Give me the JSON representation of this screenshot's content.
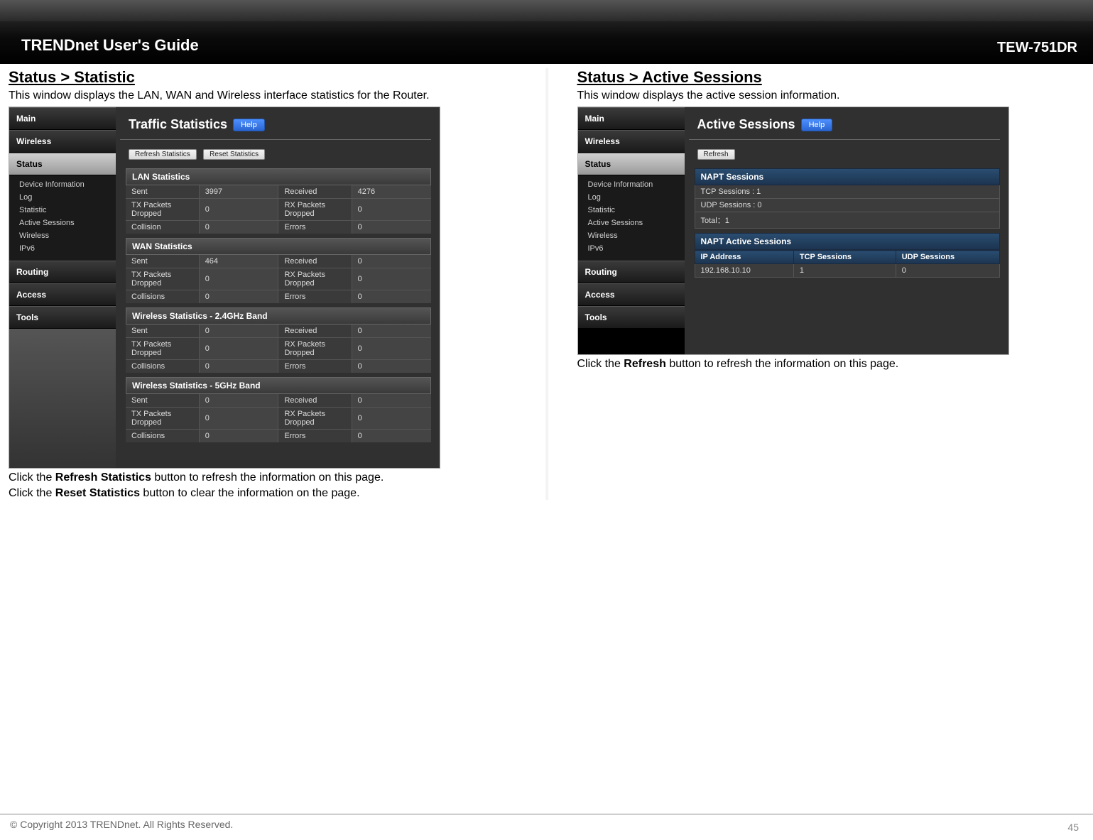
{
  "header": {
    "guide": "TRENDnet User's Guide",
    "model": "TEW-751DR"
  },
  "left": {
    "title": "Status > Statistic",
    "desc": "This window displays the LAN, WAN and Wireless interface statistics for the Router.",
    "panel_title": "Traffic Statistics",
    "help": "Help",
    "btn_refresh": "Refresh Statistics",
    "btn_reset": "Reset Statistics",
    "sections": {
      "lan": {
        "head": "LAN Statistics",
        "r1c1": "Sent",
        "r1c2": "3997",
        "r1c3": "Received",
        "r1c4": "4276",
        "r2c1": "TX Packets Dropped",
        "r2c2": "0",
        "r2c3": "RX Packets Dropped",
        "r2c4": "0",
        "r3c1": "Collision",
        "r3c2": "0",
        "r3c3": "Errors",
        "r3c4": "0"
      },
      "wan": {
        "head": "WAN Statistics",
        "r1c1": "Sent",
        "r1c2": "464",
        "r1c3": "Received",
        "r1c4": "0",
        "r2c1": "TX Packets Dropped",
        "r2c2": "0",
        "r2c3": "RX Packets Dropped",
        "r2c4": "0",
        "r3c1": "Collisions",
        "r3c2": "0",
        "r3c3": "Errors",
        "r3c4": "0"
      },
      "w24": {
        "head": "Wireless Statistics - 2.4GHz Band",
        "r1c1": "Sent",
        "r1c2": "0",
        "r1c3": "Received",
        "r1c4": "0",
        "r2c1": "TX Packets Dropped",
        "r2c2": "0",
        "r2c3": "RX Packets Dropped",
        "r2c4": "0",
        "r3c1": "Collisions",
        "r3c2": "0",
        "r3c3": "Errors",
        "r3c4": "0"
      },
      "w5": {
        "head": "Wireless Statistics - 5GHz Band",
        "r1c1": "Sent",
        "r1c2": "0",
        "r1c3": "Received",
        "r1c4": "0",
        "r2c1": "TX Packets Dropped",
        "r2c2": "0",
        "r2c3": "RX Packets Dropped",
        "r2c4": "0",
        "r3c1": "Collisions",
        "r3c2": "0",
        "r3c3": "Errors",
        "r3c4": "0"
      }
    },
    "instr1_pre": "Click the ",
    "instr1_b": "Refresh Statistics",
    "instr1_post": " button to refresh the information on this page.",
    "instr2_pre": "Click the ",
    "instr2_b": "Reset Statistics",
    "instr2_post": " button to clear the information on the page."
  },
  "right": {
    "title": "Status > Active Sessions",
    "desc": "This window displays the active session information.",
    "panel_title": "Active Sessions",
    "help": "Help",
    "btn_refresh": "Refresh",
    "napt_head": "NAPT Sessions",
    "tcp": "TCP Sessions : 1",
    "udp": "UDP Sessions : 0",
    "total": "Total：1",
    "active_head": "NAPT Active Sessions",
    "th_ip": "IP Address",
    "th_tcp": "TCP Sessions",
    "th_udp": "UDP Sessions",
    "row_ip": "192.168.10.10",
    "row_tcp": "1",
    "row_udp": "0",
    "instr_pre": "Click the ",
    "instr_b": "Refresh",
    "instr_post": " button to refresh the information on this page."
  },
  "sidebar": {
    "main": "Main",
    "wireless": "Wireless",
    "status": "Status",
    "routing": "Routing",
    "access": "Access",
    "tools": "Tools",
    "sub": {
      "di": "Device Information",
      "log": "Log",
      "stat": "Statistic",
      "as": "Active Sessions",
      "wl": "Wireless",
      "ipv6": "IPv6"
    }
  },
  "footer": {
    "copy": "© Copyright 2013 TRENDnet. All Rights Reserved.",
    "page": "45"
  }
}
